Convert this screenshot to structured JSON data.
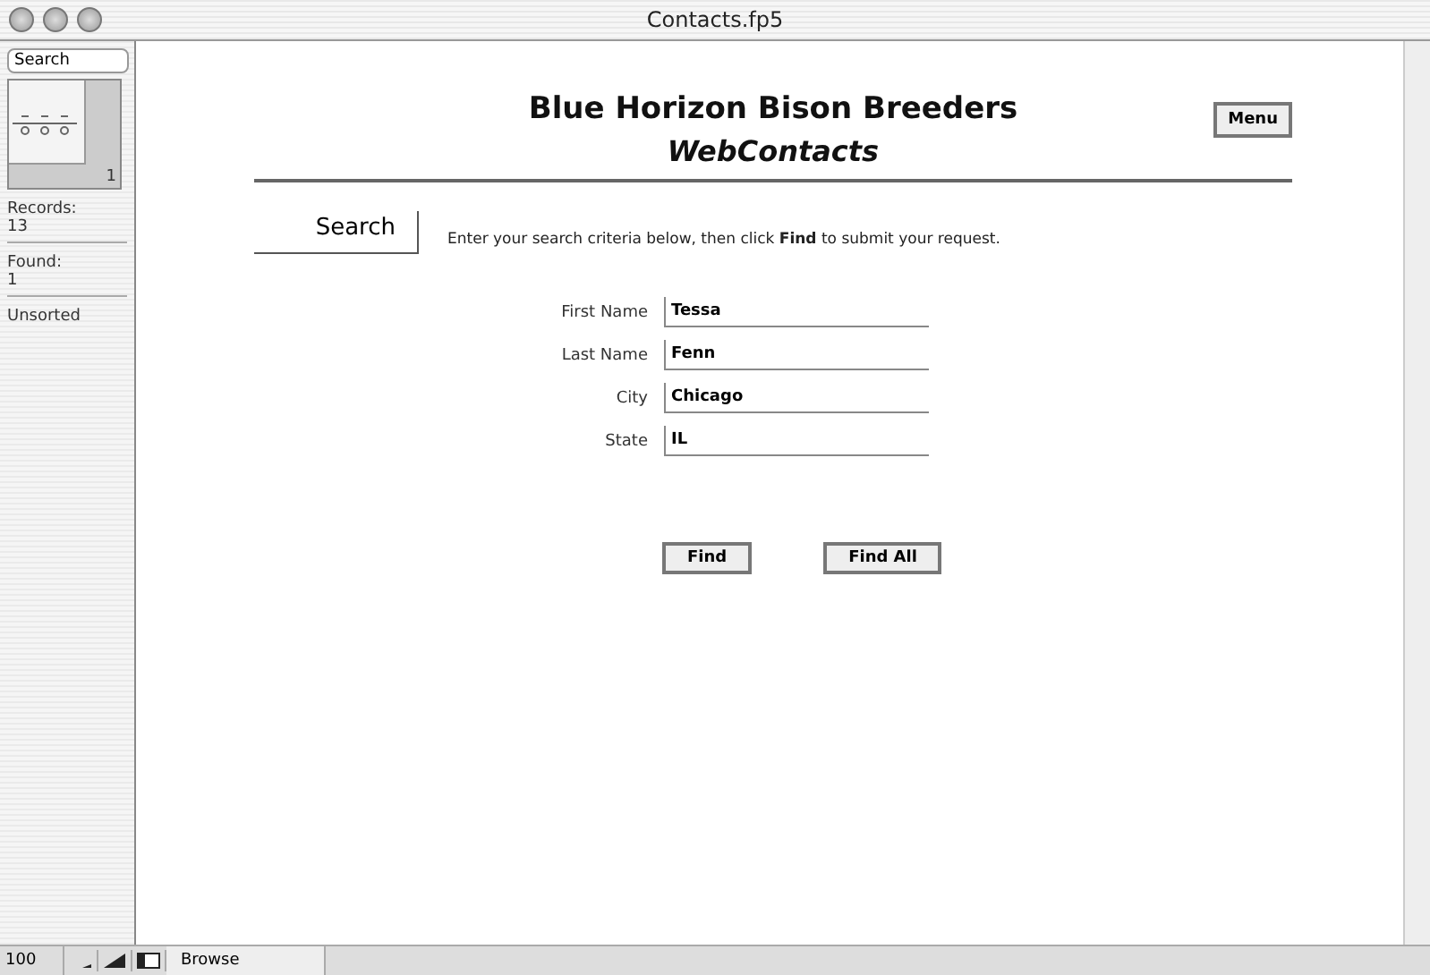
{
  "window": {
    "title": "Contacts.fp5"
  },
  "sidebar": {
    "mode": "Search",
    "book_page": "1",
    "records_label": "Records:",
    "records": "13",
    "found_label": "Found:",
    "found": "1",
    "sort": "Unsorted"
  },
  "header": {
    "title": "Blue Horizon Bison Breeders",
    "subtitle": "WebContacts",
    "menu_button": "Menu"
  },
  "section": {
    "label": "Search",
    "instruction": "Enter your search criteria below, then click **Find** to submit your request."
  },
  "fields": [
    {
      "label": "First Name",
      "value": "Tessa"
    },
    {
      "label": "Last Name",
      "value": "Fenn"
    },
    {
      "label": "City",
      "value": "Chicago"
    },
    {
      "label": "State",
      "value": "IL"
    }
  ],
  "buttons": [
    "Find",
    "Find All"
  ],
  "status_bar": {
    "zoom": "100",
    "mode": "Browse"
  }
}
